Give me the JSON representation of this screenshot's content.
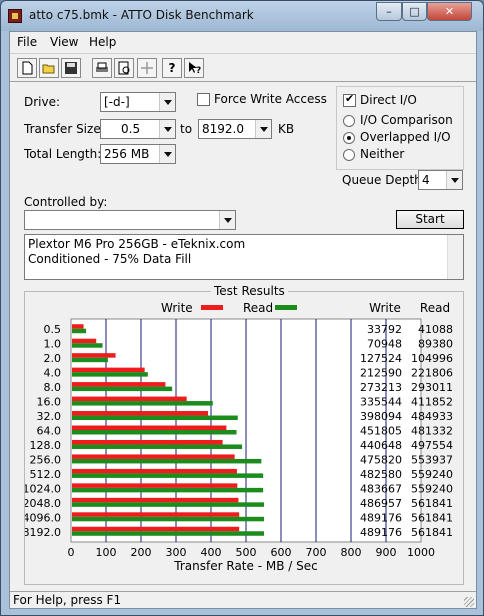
{
  "window": {
    "title": "atto c75.bmk - ATTO Disk Benchmark"
  },
  "menu": [
    "File",
    "View",
    "Help"
  ],
  "toolbar": {
    "icons": [
      "new-icon",
      "open-icon",
      "save-icon",
      "print-icon",
      "print-preview-icon",
      "move-icon",
      "help-icon",
      "context-help-icon"
    ],
    "help_glyph": "?"
  },
  "form": {
    "drive_label": "Drive:",
    "drive_value": "[-d-]",
    "force_write_label": "Force Write Access",
    "force_write_checked": false,
    "direct_io_label": "Direct I/O",
    "direct_io_checked": true,
    "transfer_size_label": "Transfer Size:",
    "transfer_from": "0.5",
    "to_label": "to",
    "transfer_to": "8192.0",
    "unit": "KB",
    "total_length_label": "Total Length:",
    "total_length_value": "256 MB",
    "io_options": [
      {
        "label": "I/O Comparison",
        "selected": false
      },
      {
        "label": "Overlapped I/O",
        "selected": true
      },
      {
        "label": "Neither",
        "selected": false
      }
    ],
    "queue_depth_label": "Queue Depth:",
    "queue_depth_value": "4",
    "controlled_by_label": "Controlled by:",
    "controlled_by_value": "",
    "start_label": "Start",
    "description_lines": [
      "Plextor M6 Pro 256GB - eTeknix.com",
      "Conditioned - 75% Data Fill"
    ]
  },
  "status": {
    "text": "For Help, press F1"
  },
  "chart_data": {
    "type": "bar",
    "title": "Test Results",
    "legend": [
      {
        "name": "Write",
        "color": "#ee1c1c"
      },
      {
        "name": "Read",
        "color": "#1c8c1c"
      }
    ],
    "categories": [
      "0.5",
      "1.0",
      "2.0",
      "4.0",
      "8.0",
      "16.0",
      "32.0",
      "64.0",
      "128.0",
      "256.0",
      "512.0",
      "1024.0",
      "2048.0",
      "4096.0",
      "8192.0"
    ],
    "series": [
      {
        "name": "Write",
        "color": "#ee1c1c",
        "values": [
          33792,
          70948,
          127524,
          212590,
          273213,
          335544,
          398094,
          451805,
          440648,
          475820,
          482580,
          483667,
          486957,
          489176,
          489176
        ]
      },
      {
        "name": "Read",
        "color": "#1c8c1c",
        "values": [
          41088,
          89380,
          104996,
          221806,
          293011,
          411852,
          484933,
          481332,
          497554,
          553937,
          559240,
          559240,
          561841,
          561841,
          561841
        ]
      }
    ],
    "columns": {
      "write": "Write",
      "read": "Read"
    },
    "xlabel": "Transfer Rate - MB / Sec",
    "xlim": [
      0,
      1000
    ],
    "xticks": [
      "0",
      "100",
      "200",
      "300",
      "400",
      "500",
      "600",
      "700",
      "800",
      "900",
      "1000"
    ],
    "grid": true
  }
}
